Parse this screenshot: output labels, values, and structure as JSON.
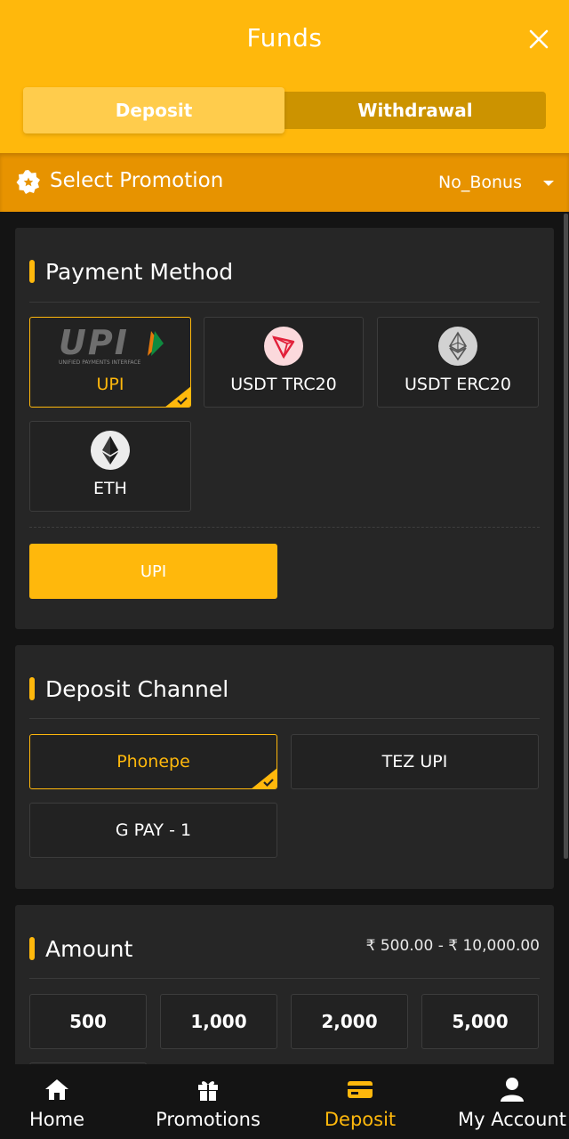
{
  "header": {
    "title": "Funds",
    "tabs": [
      "Deposit",
      "Withdrawal"
    ],
    "active_tab": "Deposit"
  },
  "promotion": {
    "label": "Select Promotion",
    "value": "No_Bonus"
  },
  "payment": {
    "title": "Payment Method",
    "upi_logo_text": "UPI",
    "upi_logo_subtext": "UNIFIED PAYMENTS INTERFACE",
    "methods": [
      {
        "label": "UPI",
        "icon": "upi-logo",
        "selected": true
      },
      {
        "label": "USDT TRC20",
        "icon": "tron-icon",
        "selected": false
      },
      {
        "label": "USDT ERC20",
        "icon": "ethereum-grey-icon",
        "selected": false
      },
      {
        "label": "ETH",
        "icon": "ethereum-icon",
        "selected": false
      }
    ],
    "submethod_button": "UPI"
  },
  "channel": {
    "title": "Deposit Channel",
    "options": [
      {
        "label": "Phonepe",
        "selected": true
      },
      {
        "label": "TEZ UPI",
        "selected": false
      },
      {
        "label": "G PAY - 1",
        "selected": false
      }
    ]
  },
  "amount": {
    "title": "Amount",
    "range": "₹ 500.00 - ₹ 10,000.00",
    "presets": [
      "500",
      "1,000",
      "2,000",
      "5,000"
    ]
  },
  "nav": {
    "items": [
      {
        "label": "Home",
        "icon": "home-icon"
      },
      {
        "label": "Promotions",
        "icon": "gift-icon"
      },
      {
        "label": "Deposit",
        "icon": "wallet-icon"
      },
      {
        "label": "My Account",
        "icon": "user-icon"
      }
    ],
    "active": "Deposit"
  },
  "colors": {
    "accent": "#ffb80c",
    "header": "#ffb80c",
    "promo_bar": "#e79300",
    "card": "#262626",
    "background": "#141414"
  }
}
